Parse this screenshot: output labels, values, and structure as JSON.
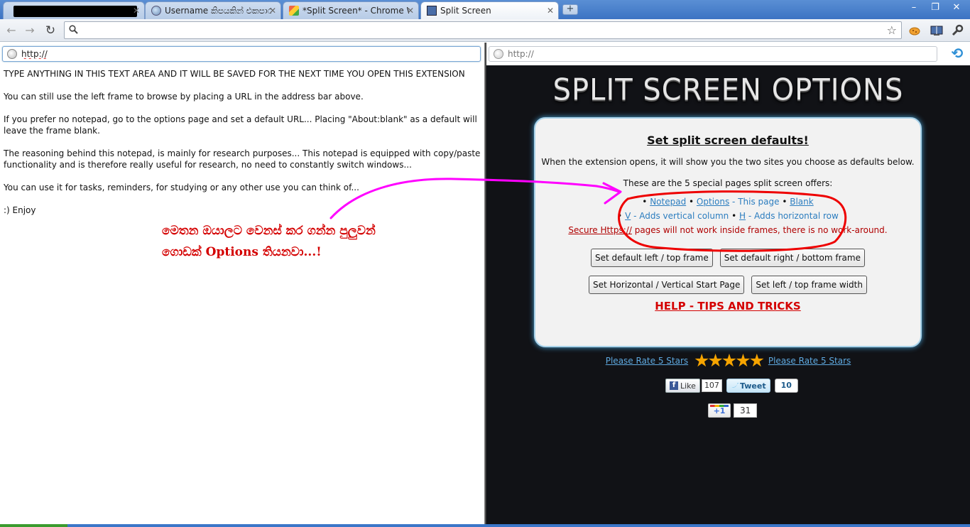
{
  "browser": {
    "tabs": [
      {
        "label": "",
        "redacted": true
      },
      {
        "label": "Username කිපයකින් එකපාර L"
      },
      {
        "label": "*Split Screen* - Chrome Web"
      },
      {
        "label": "Split Screen",
        "active": true
      }
    ],
    "newtab_label": "+",
    "window_buttons": {
      "minimize": "–",
      "maximize": "❐",
      "close": "✕"
    },
    "omnibox_value": ""
  },
  "left_frame": {
    "address_value": "http://",
    "notepad": [
      "TYPE ANYTHING IN THIS TEXT AREA AND IT WILL BE SAVED FOR THE NEXT TIME YOU OPEN THIS EXTENSION",
      "You can still use the left frame to browse by placing a URL in the address bar above.",
      "If you prefer no notepad, go to the options page and set a default URL... Placing \"About:blank\" as a default will leave the frame blank.",
      "The reasoning behind this notepad, is mainly for research purposes... This notepad is equipped with copy/paste functionality and is therefore really useful for research, no need to constantly switch windows...",
      "You can use it for tasks, reminders, for studying or any other use you can think of...",
      ":) Enjoy"
    ],
    "annotation_line1": "මෙතන ඔයාලට වෙනස් කර ගන්න පුලුවන්",
    "annotation_line2": "ගොඩක් Options තියනවා...!"
  },
  "right_frame": {
    "address_placeholder": "http://",
    "page_title": "SPLIT SCREEN OPTIONS",
    "box": {
      "heading": "Set split screen defaults!",
      "description": "When the extension opens, it will show you the two sites you choose as defaults below.",
      "special_pages": "These are the 5 special pages split screen offers:",
      "link_notepad": "Notepad",
      "link_options": "Options",
      "options_note": " - This page",
      "link_blank": "Blank",
      "link_v": "V",
      "v_note": " - Adds vertical column",
      "link_h": "H",
      "h_note": " - Adds horizontal row",
      "secure_link": "Secure Https://",
      "secure_note": " pages will not work inside frames, there is no work-around.",
      "btn_left_top": "Set default left / top frame",
      "btn_right_bottom": "Set default right / bottom frame",
      "btn_start_page": "Set Horizontal / Vertical Start Page",
      "btn_frame_width": "Set left / top frame width",
      "help_link": "HELP - TIPS AND TRICKS"
    },
    "rate_left": "Please Rate 5 Stars",
    "rate_right": "Please Rate 5 Stars",
    "stars": "★★★★★",
    "fb_like_label": "Like",
    "fb_like_count": "107",
    "tweet_label": "Tweet",
    "tweet_count": "10",
    "gplus_label": "+1",
    "gplus_count": "31"
  },
  "colors": {
    "annotation_red": "#d40000",
    "annotation_magenta": "#ff00ff",
    "accent_blue": "#2c7dbf",
    "glow_blue": "#49a4d8"
  }
}
